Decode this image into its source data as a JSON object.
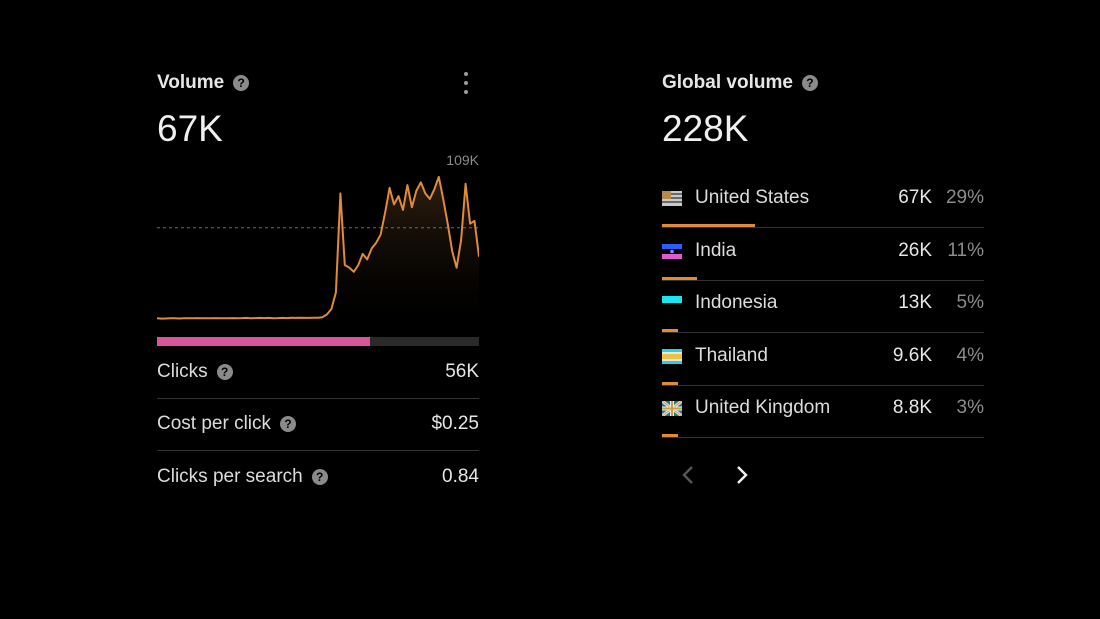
{
  "volume_card": {
    "title": "Volume",
    "value": "67K",
    "chart_max_label": "109K",
    "clicks_share": 0.66,
    "metrics": [
      {
        "label": "Clicks",
        "value": "56K"
      },
      {
        "label": "Cost per click",
        "value": "$0.25"
      },
      {
        "label": "Clicks per search",
        "value": "0.84"
      }
    ],
    "colors": {
      "line": "#e08a3c",
      "bar": "#d6559b"
    }
  },
  "chart_data": {
    "type": "area",
    "ylim": [
      0,
      109000
    ],
    "reference_line": 67000,
    "values": [
      1200,
      1000,
      1100,
      1200,
      1200,
      1100,
      1300,
      1200,
      1300,
      1400,
      1300,
      1200,
      1300,
      1400,
      1300,
      1200,
      1200,
      1400,
      1300,
      1400,
      1500,
      1300,
      1400,
      1500,
      1400,
      1500,
      1300,
      1400,
      1500,
      1400,
      1600,
      1500,
      1600,
      1500,
      1500,
      1600,
      1700,
      2000,
      4000,
      8000,
      20000,
      92000,
      40000,
      38000,
      35000,
      40000,
      48000,
      44000,
      52000,
      56000,
      62000,
      78000,
      96000,
      84000,
      90000,
      80000,
      98000,
      82000,
      94000,
      100000,
      92000,
      88000,
      95000,
      104000,
      88000,
      70000,
      50000,
      38000,
      58000,
      99000,
      70000,
      72000,
      46000
    ]
  },
  "global_card": {
    "title": "Global volume",
    "value": "228K",
    "countries": [
      {
        "name": "United States",
        "volume": "67K",
        "percent": "29%",
        "share": 0.29,
        "flag": "us-flag-icon"
      },
      {
        "name": "India",
        "volume": "26K",
        "percent": "11%",
        "share": 0.11,
        "flag": "india-flag-icon"
      },
      {
        "name": "Indonesia",
        "volume": "13K",
        "percent": "5%",
        "share": 0.05,
        "flag": "indonesia-flag-icon"
      },
      {
        "name": "Thailand",
        "volume": "9.6K",
        "percent": "4%",
        "share": 0.04,
        "flag": "thailand-flag-icon"
      },
      {
        "name": "United Kingdom",
        "volume": "8.8K",
        "percent": "3%",
        "share": 0.03,
        "flag": "uk-flag-icon"
      }
    ]
  }
}
